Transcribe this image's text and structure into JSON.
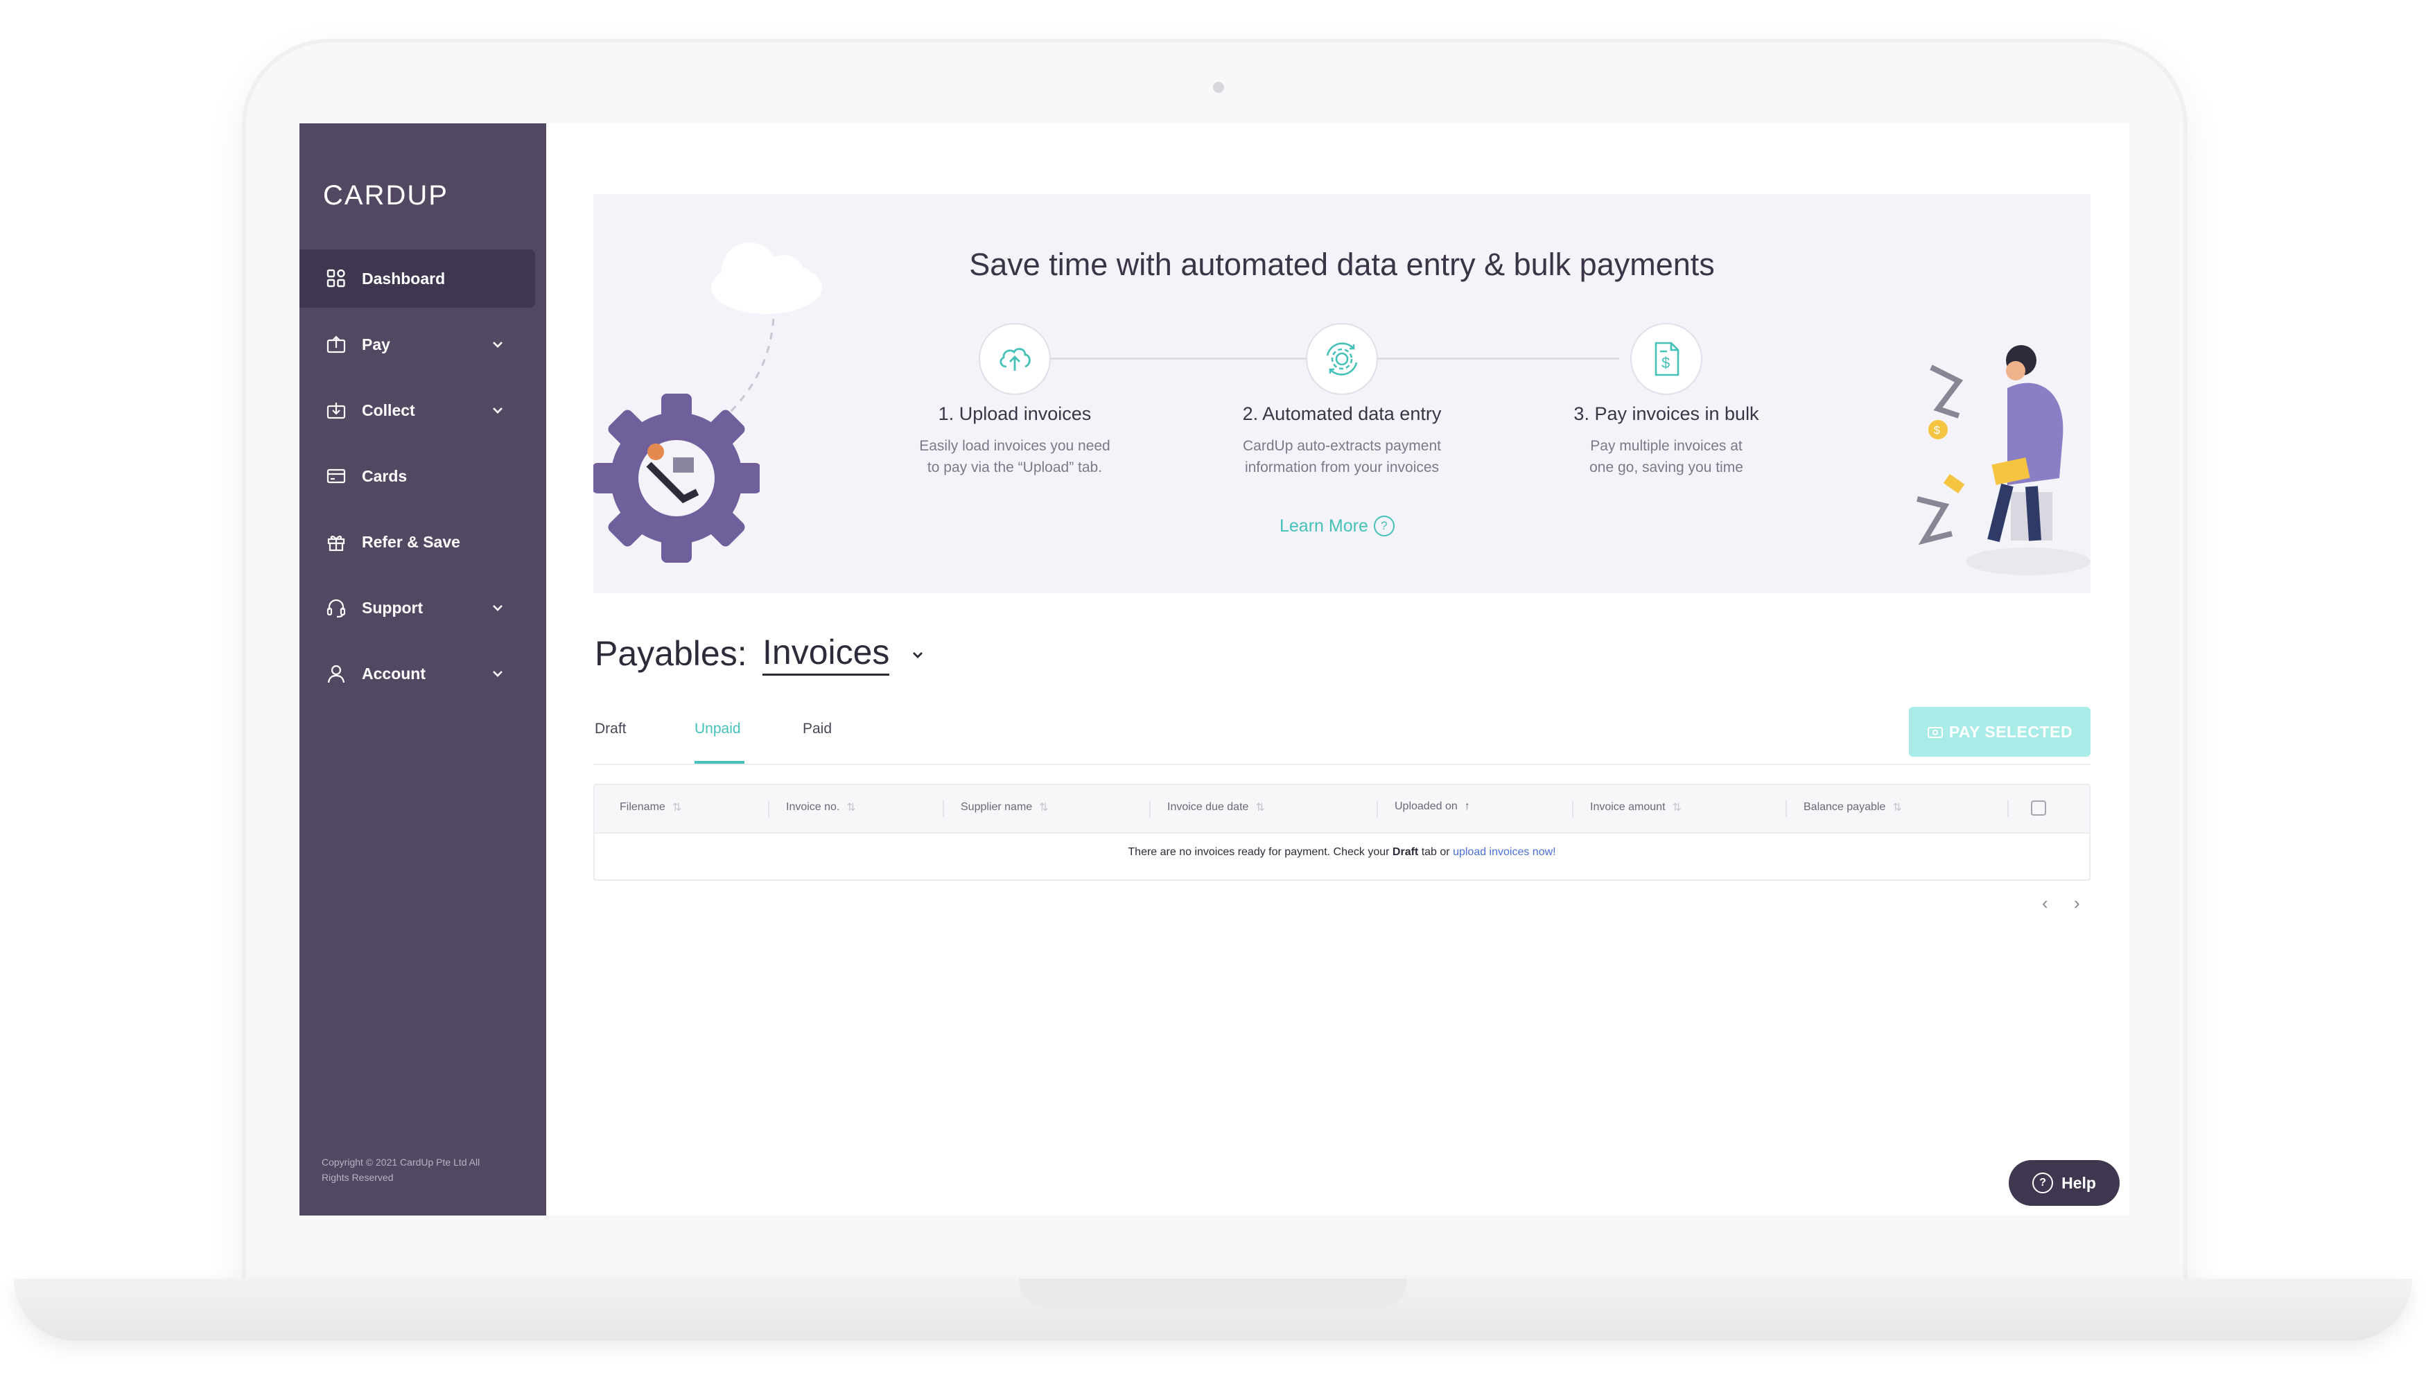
{
  "app": {
    "logo_text": "CARDUP"
  },
  "sidebar": {
    "items": [
      {
        "label": "Dashboard",
        "icon": "grid-icon"
      },
      {
        "label": "Pay",
        "icon": "wallet-up-icon"
      },
      {
        "label": "Collect",
        "icon": "wallet-down-icon"
      },
      {
        "label": "Cards",
        "icon": "card-icon"
      },
      {
        "label": "Refer & Save",
        "icon": "gift-icon"
      },
      {
        "label": "Support",
        "icon": "headset-icon"
      },
      {
        "label": "Account",
        "icon": "user-icon"
      }
    ],
    "copyright": "Copyright © 2021 CardUp Pte Ltd All Rights Reserved"
  },
  "banner": {
    "title": "Save time with automated data entry & bulk payments",
    "steps": [
      {
        "title": "1. Upload invoices",
        "desc": "Easily load invoices you need\nto pay via the “Upload” tab.",
        "icon": "cloud-upload-icon"
      },
      {
        "title": "2. Automated data entry",
        "desc": "CardUp auto-extracts payment\ninformation from your invoices",
        "icon": "gear-sync-icon"
      },
      {
        "title": "3. Pay invoices in bulk",
        "desc": "Pay multiple invoices at\none go, saving you time",
        "icon": "invoice-dollar-icon"
      }
    ],
    "learn_more": "Learn More"
  },
  "payables": {
    "title": "Payables:",
    "selected": "Invoices",
    "tabs": [
      "Draft",
      "Unpaid",
      "Paid"
    ],
    "active_tab": "Unpaid",
    "pay_selected": "PAY SELECTED"
  },
  "table": {
    "columns": [
      "Filename",
      "Invoice no.",
      "Supplier name",
      "Invoice due date",
      "Uploaded on",
      "Invoice amount",
      "Balance payable"
    ],
    "empty_prefix": "There are no invoices ready for payment. Check your ",
    "empty_bold": "Draft",
    "empty_middle": " tab or ",
    "empty_link": "upload invoices now!"
  },
  "pager": {
    "prev": "‹",
    "next": "›"
  },
  "help": {
    "label": "Help"
  },
  "colors": {
    "sidebar": "#524862",
    "accent": "#45c1b8",
    "dark": "#3f3750"
  }
}
